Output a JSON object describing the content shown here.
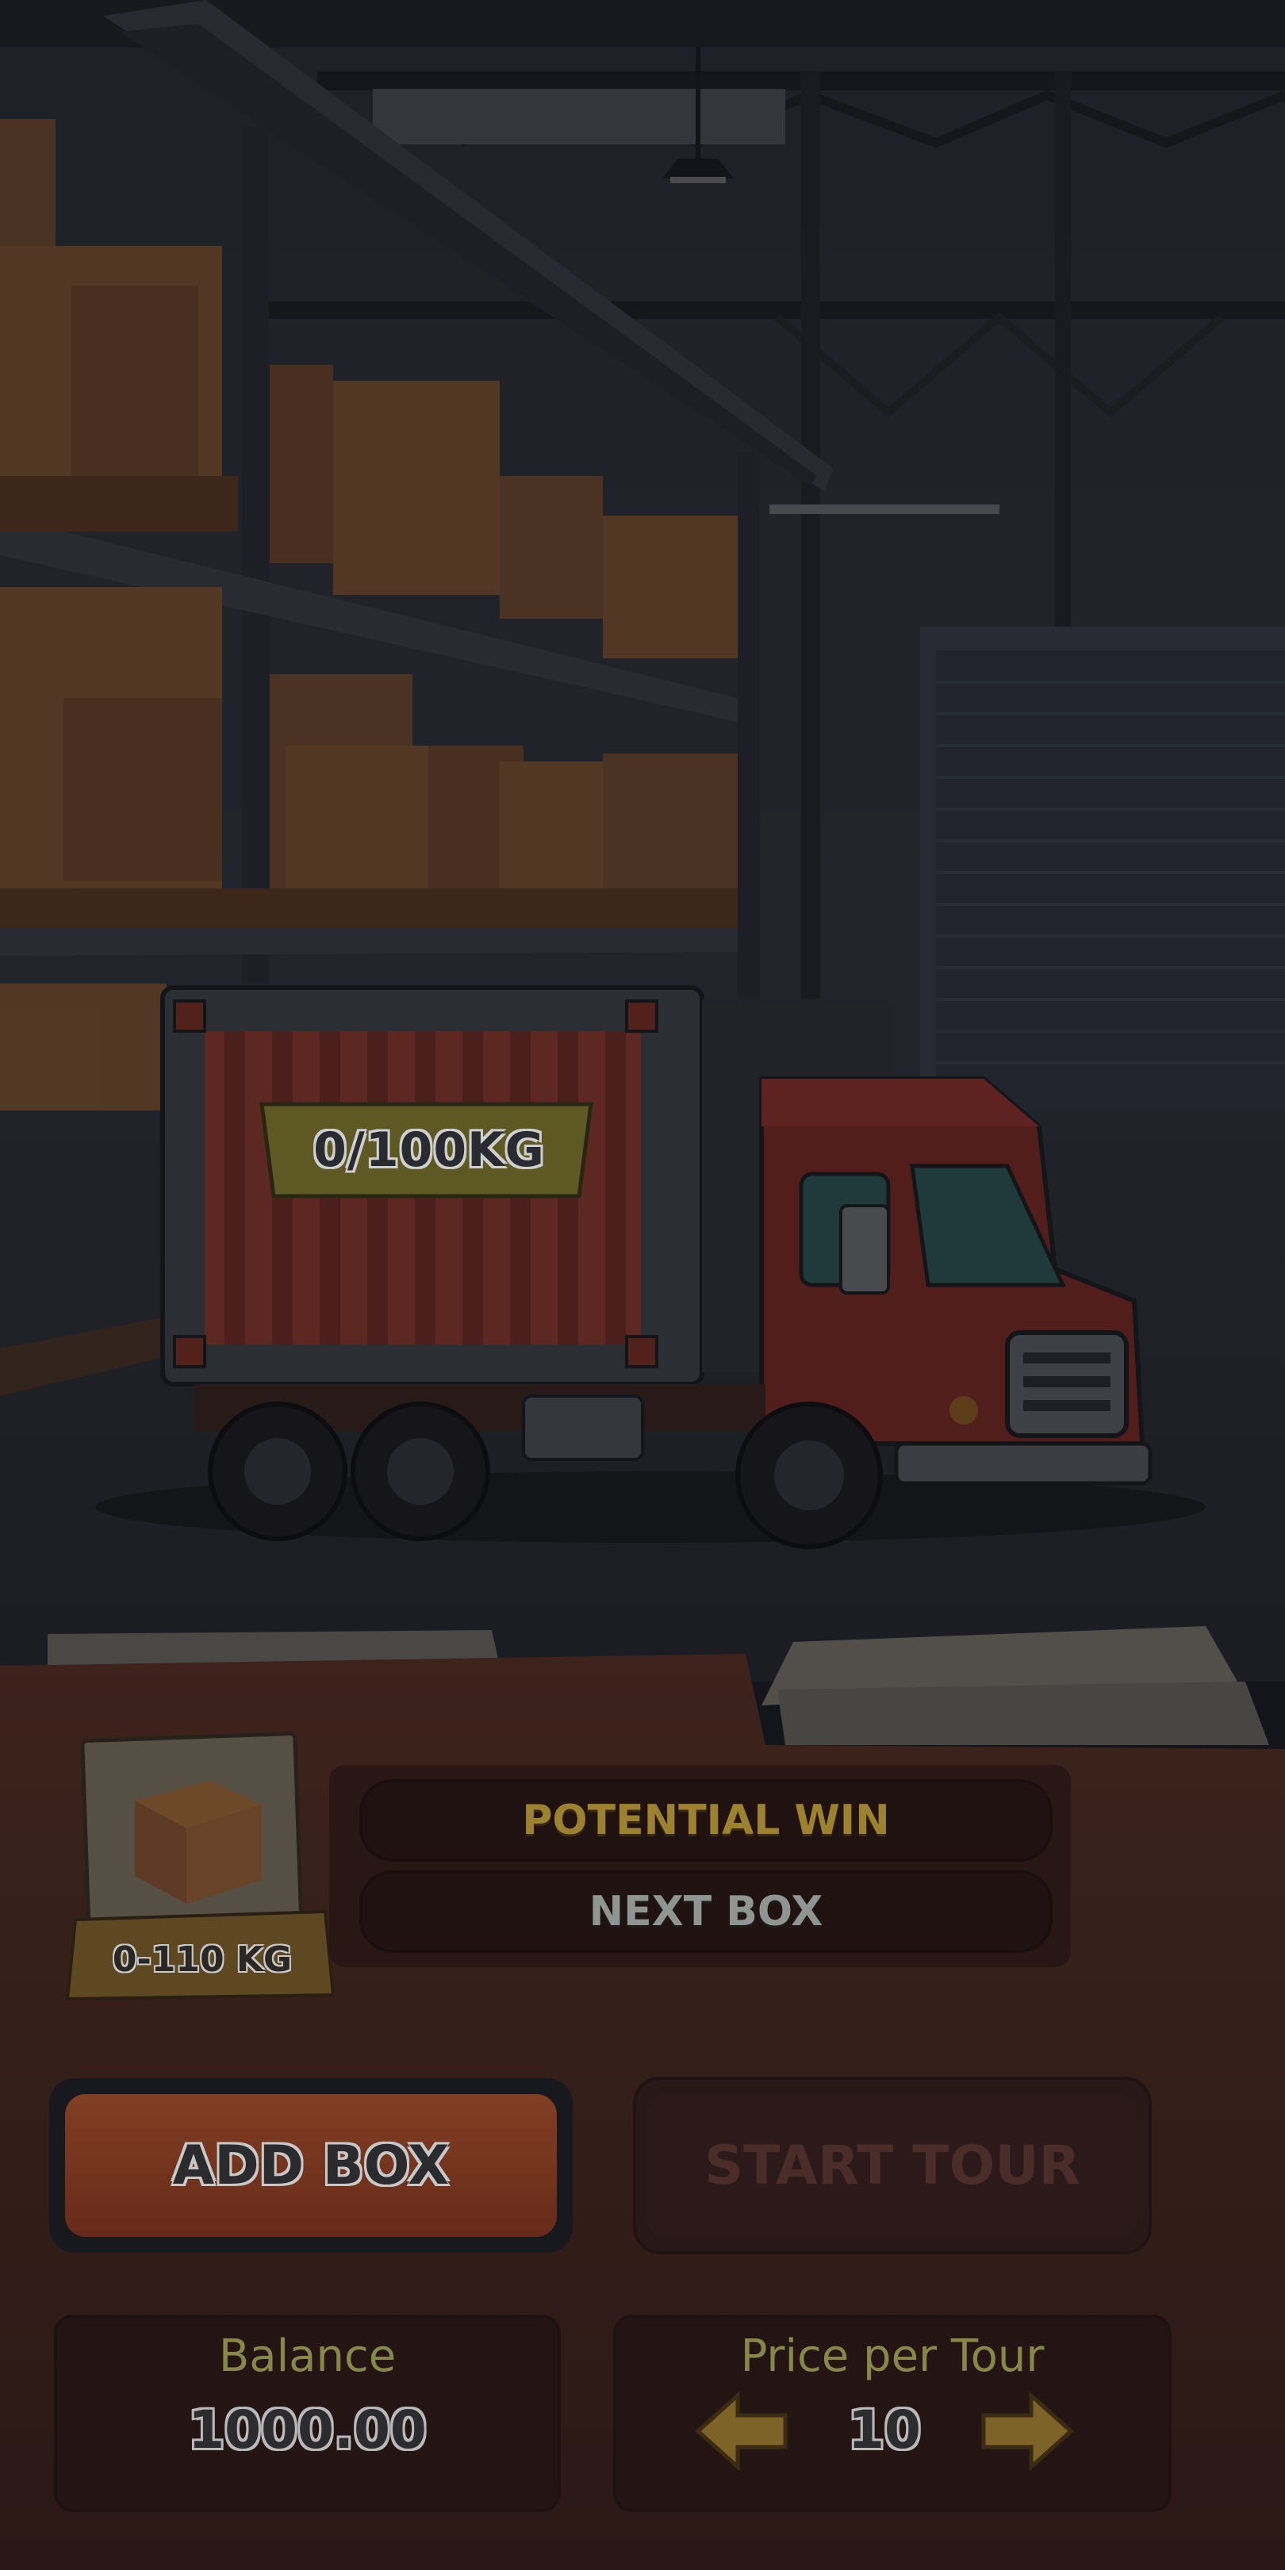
{
  "truck": {
    "cargo_label": "0/100KG"
  },
  "info": {
    "potential_win_label": "POTENTIAL WIN",
    "next_box_label": "NEXT BOX",
    "box_weight": "0-110 KG"
  },
  "controls": {
    "add_box_label": "ADD BOX",
    "start_tour_label": "START TOUR"
  },
  "balance": {
    "label": "Balance",
    "value": "1000.00"
  },
  "price": {
    "label": "Price per Tour",
    "value": "10"
  },
  "icons": {
    "decrease": "arrow-left-icon",
    "increase": "arrow-right-icon",
    "box": "cardboard-box-icon"
  },
  "colors": {
    "accent_orange": "#b8522a",
    "panel_brown": "#4a2a22",
    "gold": "#9c8130"
  }
}
